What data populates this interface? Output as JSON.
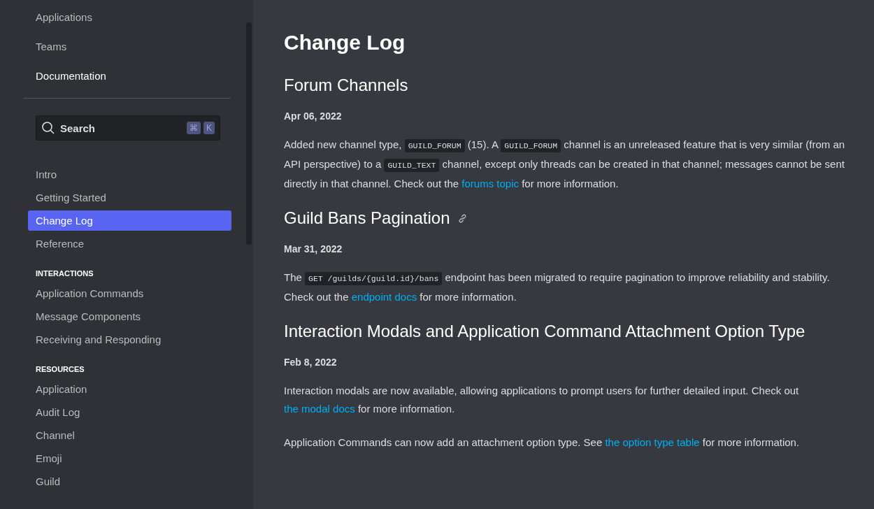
{
  "top_nav": [
    {
      "label": "Applications",
      "selected": false
    },
    {
      "label": "Teams",
      "selected": false
    },
    {
      "label": "Documentation",
      "selected": true
    }
  ],
  "search": {
    "placeholder": "Search",
    "keys": [
      "⌘",
      "K"
    ]
  },
  "sidebar": {
    "items": [
      {
        "label": "Intro",
        "selected": false
      },
      {
        "label": "Getting Started",
        "selected": false
      },
      {
        "label": "Change Log",
        "selected": true
      },
      {
        "label": "Reference",
        "selected": false
      }
    ],
    "sections": [
      {
        "title": "INTERACTIONS",
        "items": [
          {
            "label": "Application Commands",
            "selected": false
          },
          {
            "label": "Message Components",
            "selected": false
          },
          {
            "label": "Receiving and Responding",
            "selected": false
          }
        ]
      },
      {
        "title": "RESOURCES",
        "items": [
          {
            "label": "Application",
            "selected": false
          },
          {
            "label": "Audit Log",
            "selected": false
          },
          {
            "label": "Channel",
            "selected": false
          },
          {
            "label": "Emoji",
            "selected": false
          },
          {
            "label": "Guild",
            "selected": false
          }
        ]
      }
    ]
  },
  "page": {
    "title": "Change Log",
    "entries": [
      {
        "title": "Forum Channels",
        "anchor": false,
        "date": "Apr 06, 2022",
        "paragraphs": [
          [
            {
              "kind": "text",
              "text": "Added new channel type, "
            },
            {
              "kind": "code",
              "text": "GUILD_FORUM"
            },
            {
              "kind": "text",
              "text": " (15). A "
            },
            {
              "kind": "code",
              "text": "GUILD_FORUM"
            },
            {
              "kind": "text",
              "text": " channel is an unreleased feature that is very similar (from an API perspective) to a "
            },
            {
              "kind": "code",
              "text": "GUILD_TEXT"
            },
            {
              "kind": "text",
              "text": " channel, except only threads can be created in that channel; messages cannot be sent directly in that channel. Check out the "
            },
            {
              "kind": "link",
              "text": "forums topic"
            },
            {
              "kind": "text",
              "text": " for more information."
            }
          ]
        ]
      },
      {
        "title": "Guild Bans Pagination",
        "anchor": true,
        "date": "Mar 31, 2022",
        "paragraphs": [
          [
            {
              "kind": "text",
              "text": "The "
            },
            {
              "kind": "code",
              "text": "GET /guilds/{guild.id}/bans"
            },
            {
              "kind": "text",
              "text": " endpoint has been migrated to require pagination to improve reliability and stability. Check out the "
            },
            {
              "kind": "link",
              "text": "endpoint docs"
            },
            {
              "kind": "text",
              "text": " for more information."
            }
          ]
        ]
      },
      {
        "title": "Interaction Modals and Application Command Attachment Option Type",
        "anchor": false,
        "date": "Feb 8, 2022",
        "paragraphs": [
          [
            {
              "kind": "text",
              "text": "Interaction modals are now available, allowing applications to prompt users for further detailed input. Check out "
            },
            {
              "kind": "link",
              "text": "the modal docs"
            },
            {
              "kind": "text",
              "text": " for more information."
            }
          ],
          [
            {
              "kind": "text",
              "text": "Application Commands can now add an attachment option type. See "
            },
            {
              "kind": "link",
              "text": "the option type table"
            },
            {
              "kind": "text",
              "text": " for more information."
            }
          ]
        ]
      }
    ]
  }
}
